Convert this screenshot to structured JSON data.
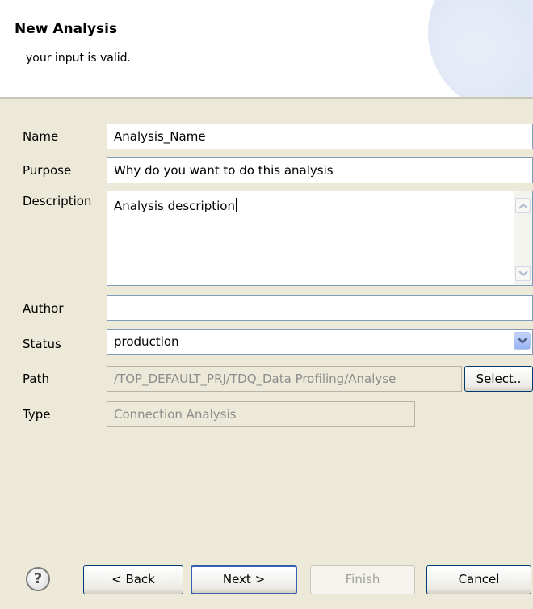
{
  "dialog": {
    "title": "New Analysis",
    "message": "your input is valid."
  },
  "form": {
    "name": {
      "label": "Name",
      "value": "Analysis_Name"
    },
    "purpose": {
      "label": "Purpose",
      "value": "Why do you want to do this analysis"
    },
    "description": {
      "label": "Description",
      "value": "Analysis description"
    },
    "author": {
      "label": "Author",
      "value": ""
    },
    "status": {
      "label": "Status",
      "value": "production"
    },
    "path": {
      "label": "Path",
      "value": "/TOP_DEFAULT_PRJ/TDQ_Data Profiling/Analyse",
      "select_label": "Select.."
    },
    "type": {
      "label": "Type",
      "value": "Connection Analysis"
    }
  },
  "buttons": {
    "help": "?",
    "back": "< Back",
    "next": "Next >",
    "finish": "Finish",
    "cancel": "Cancel"
  },
  "icons": {
    "help": "help-icon",
    "scroll_up": "scroll-up-icon",
    "scroll_down": "scroll-down-icon",
    "dropdown": "chevron-down-icon"
  },
  "colors": {
    "dialog_bg": "#ece9d8",
    "header_bg": "#ffffff",
    "field_border": "#7f9db9",
    "default_button_border": "#365fb0"
  }
}
